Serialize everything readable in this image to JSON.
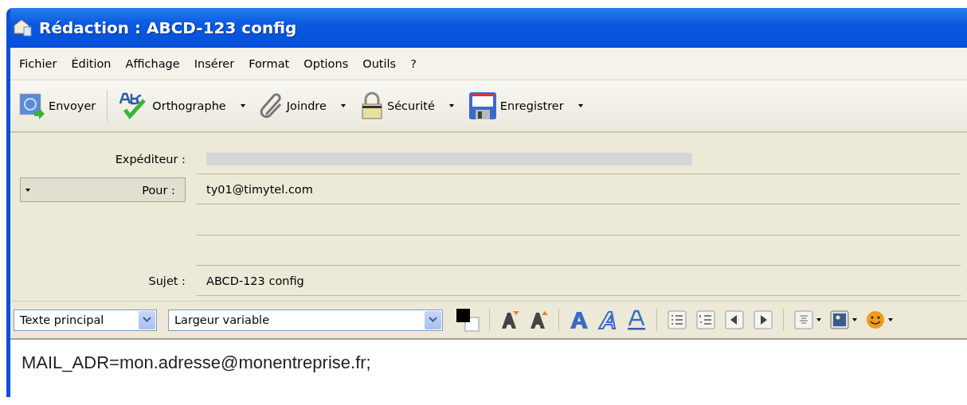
{
  "window": {
    "title": "Rédaction : ABCD-123 config"
  },
  "menu": [
    {
      "label": "Fichier"
    },
    {
      "label": "Édition"
    },
    {
      "label": "Affichage"
    },
    {
      "label": "Insérer"
    },
    {
      "label": "Format"
    },
    {
      "label": "Options"
    },
    {
      "label": "Outils"
    },
    {
      "label": "?"
    }
  ],
  "toolbar": [
    {
      "kind": "send",
      "label": "Envoyer",
      "dropdown": false
    },
    {
      "kind": "spell",
      "label": "Orthographe",
      "dropdown": true
    },
    {
      "kind": "attach",
      "label": "Joindre",
      "dropdown": true
    },
    {
      "kind": "security",
      "label": "Sécurité",
      "dropdown": true
    },
    {
      "kind": "save",
      "label": "Enregistrer",
      "dropdown": true
    }
  ],
  "header": {
    "sender_label": "Expéditeur :",
    "recipients": [
      {
        "type_label": "Pour :",
        "value": "ty01@timytel.com"
      }
    ],
    "subject_label": "Sujet :",
    "subject": "ABCD-123 config"
  },
  "format_bar": {
    "paragraph": "Texte principal",
    "font": "Largeur variable",
    "tools": [
      {
        "kind": "color"
      },
      {
        "kind": "sep"
      },
      {
        "kind": "smaller"
      },
      {
        "kind": "larger"
      },
      {
        "kind": "sep"
      },
      {
        "kind": "bold"
      },
      {
        "kind": "italic"
      },
      {
        "kind": "underline"
      },
      {
        "kind": "sep"
      },
      {
        "kind": "bullets"
      },
      {
        "kind": "numbers"
      },
      {
        "kind": "outdent"
      },
      {
        "kind": "indent"
      },
      {
        "kind": "sep"
      },
      {
        "kind": "align"
      },
      {
        "kind": "image"
      },
      {
        "kind": "smiley"
      }
    ]
  },
  "body": "MAIL_ADR=mon.adresse@monentreprise.fr;"
}
